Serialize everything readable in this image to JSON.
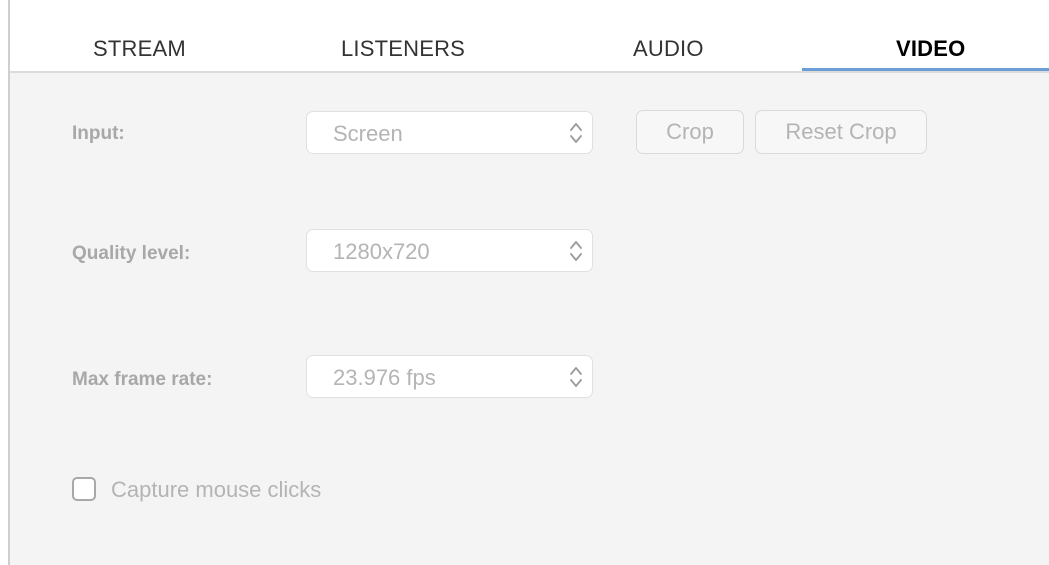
{
  "tabs": [
    {
      "label": "STREAM",
      "active": false
    },
    {
      "label": "LISTENERS",
      "active": false
    },
    {
      "label": "AUDIO",
      "active": false
    },
    {
      "label": "VIDEO",
      "active": true
    }
  ],
  "video": {
    "input": {
      "label": "Input:",
      "value": "Screen"
    },
    "crop_button": "Crop",
    "reset_crop_button": "Reset Crop",
    "quality": {
      "label": "Quality level:",
      "value": "1280x720"
    },
    "frame_rate": {
      "label": "Max frame rate:",
      "value": "23.976 fps"
    },
    "capture_clicks": {
      "label": "Capture mouse clicks",
      "checked": false
    }
  },
  "colors": {
    "accent": "#6d9dd6",
    "disabled_text": "#b4b4b4",
    "label_text": "#a8a8a8"
  }
}
